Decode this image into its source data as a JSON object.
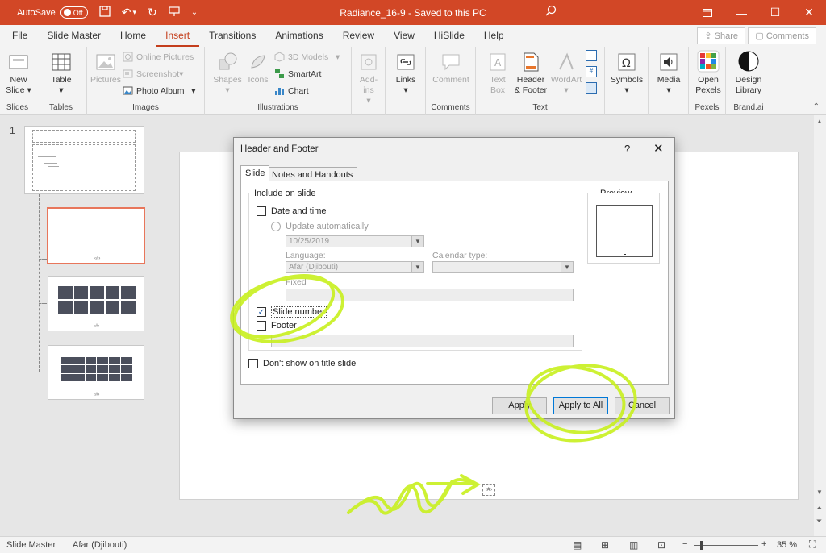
{
  "titlebar": {
    "autosave_label": "AutoSave",
    "autosave_state": "Off",
    "document_title": "Radiance_16-9",
    "save_status": "Saved to this PC",
    "accent": "#d24726"
  },
  "menu": {
    "tabs": [
      "File",
      "Slide Master",
      "Home",
      "Insert",
      "Transitions",
      "Animations",
      "Review",
      "View",
      "HiSlide",
      "Help"
    ],
    "active": "Insert",
    "share": "Share",
    "comments": "Comments"
  },
  "ribbon": {
    "new_slide": "New Slide",
    "slides_group": "Slides",
    "table": "Table",
    "tables_group": "Tables",
    "pictures": "Pictures",
    "online_pictures": "Online Pictures",
    "screenshot": "Screenshot",
    "photo_album": "Photo Album",
    "images_group": "Images",
    "shapes": "Shapes",
    "icons": "Icons",
    "models_3d": "3D Models",
    "smartart": "SmartArt",
    "chart": "Chart",
    "illustrations_group": "Illustrations",
    "addins": "Add-ins",
    "links": "Links",
    "comment": "Comment",
    "comments_group": "Comments",
    "text_box": "Text Box",
    "header_footer": "Header & Footer",
    "wordart": "WordArt",
    "text_group": "Text",
    "symbols": "Symbols",
    "media": "Media",
    "open_pexels": "Open Pexels",
    "pexels_group": "Pexels",
    "design_library": "Design Library",
    "brand_group": "Brand.ai"
  },
  "left_panel": {
    "slide_number": "1"
  },
  "slide": {
    "placeholder": "‹#›"
  },
  "status": {
    "view": "Slide Master",
    "language": "Afar (Djibouti)",
    "zoom": "35 %"
  },
  "dialog": {
    "title": "Header and Footer",
    "help": "?",
    "tab_slide": "Slide",
    "tab_notes": "Notes and Handouts",
    "include_legend": "Include on slide",
    "date_time": "Date and time",
    "update_auto": "Update automatically",
    "date_value": "10/25/2019",
    "language_label": "Language:",
    "language_value": "Afar (Djibouti)",
    "calendar_label": "Calendar type:",
    "fixed_label": "Fixed",
    "slide_number": "Slide number",
    "slide_number_checked": true,
    "footer": "Footer",
    "dont_show": "Don't show on title slide",
    "preview_legend": "Preview",
    "apply": "Apply",
    "apply_all": "Apply to All",
    "cancel": "Cancel"
  },
  "annotation": {
    "highlight_color": "#c8f01e"
  }
}
